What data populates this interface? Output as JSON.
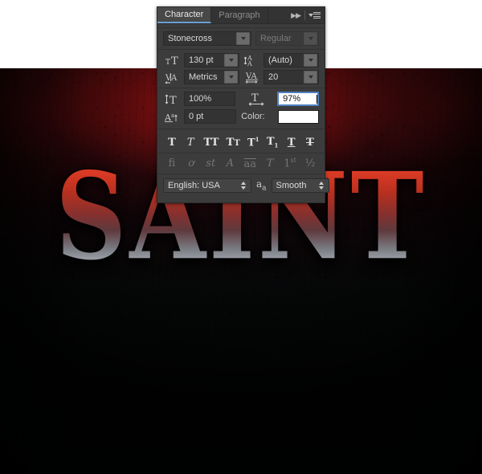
{
  "artwork": {
    "word": "SAINT",
    "background_top_color": "#4a0a0c",
    "background_bottom_color": "#020404",
    "text_gradient_top": "#e8452b",
    "text_gradient_bottom": "#a9adb4"
  },
  "panel": {
    "tabs": [
      {
        "label": "Character",
        "active": true
      },
      {
        "label": "Paragraph",
        "active": false
      }
    ],
    "icons": {
      "collapse": "collapse-to-icons-icon",
      "menu": "panel-menu-icon"
    },
    "font": {
      "family_value": "Stonecross",
      "style_value": "Regular",
      "style_disabled": true
    },
    "metrics": {
      "size_icon": "font-size-icon",
      "size_value": "130 pt",
      "leading_icon": "leading-icon",
      "leading_value": "(Auto)",
      "kerning_icon": "kerning-icon",
      "kerning_value": "Metrics",
      "tracking_icon": "tracking-icon",
      "tracking_value": "20"
    },
    "scale": {
      "vertical_icon": "vertical-scale-icon",
      "vertical_value": "100%",
      "horizontal_icon": "horizontal-scale-icon",
      "horizontal_value": "97%",
      "horizontal_focused": true,
      "baseline_icon": "baseline-shift-icon",
      "baseline_value": "0 pt",
      "color_label": "Color:",
      "color_value": "#ffffff"
    },
    "faux_styles": [
      {
        "name": "faux-bold",
        "glyph": "T"
      },
      {
        "name": "faux-italic",
        "glyph": "T"
      },
      {
        "name": "all-caps",
        "glyph": "TT"
      },
      {
        "name": "small-caps",
        "glyph": "TT"
      },
      {
        "name": "superscript",
        "glyph": "T"
      },
      {
        "name": "subscript",
        "glyph": "T"
      },
      {
        "name": "underline",
        "glyph": "T"
      },
      {
        "name": "strikethrough",
        "glyph": "T"
      }
    ],
    "opentype_styles": [
      {
        "name": "standard-ligatures",
        "glyph": "fi"
      },
      {
        "name": "discretionary-ligatures",
        "glyph": "ƿ"
      },
      {
        "name": "contextual-alternates",
        "glyph": "st"
      },
      {
        "name": "swash",
        "glyph": "A"
      },
      {
        "name": "oldstyle",
        "glyph": "aa"
      },
      {
        "name": "titling-alternates",
        "glyph": "T"
      },
      {
        "name": "ordinals",
        "glyph": "1st"
      },
      {
        "name": "fractions",
        "glyph": "½"
      }
    ],
    "bottom": {
      "language_value": "English: USA",
      "antialias_icon": "anti-alias-icon",
      "antialias_value": "Smooth"
    }
  }
}
